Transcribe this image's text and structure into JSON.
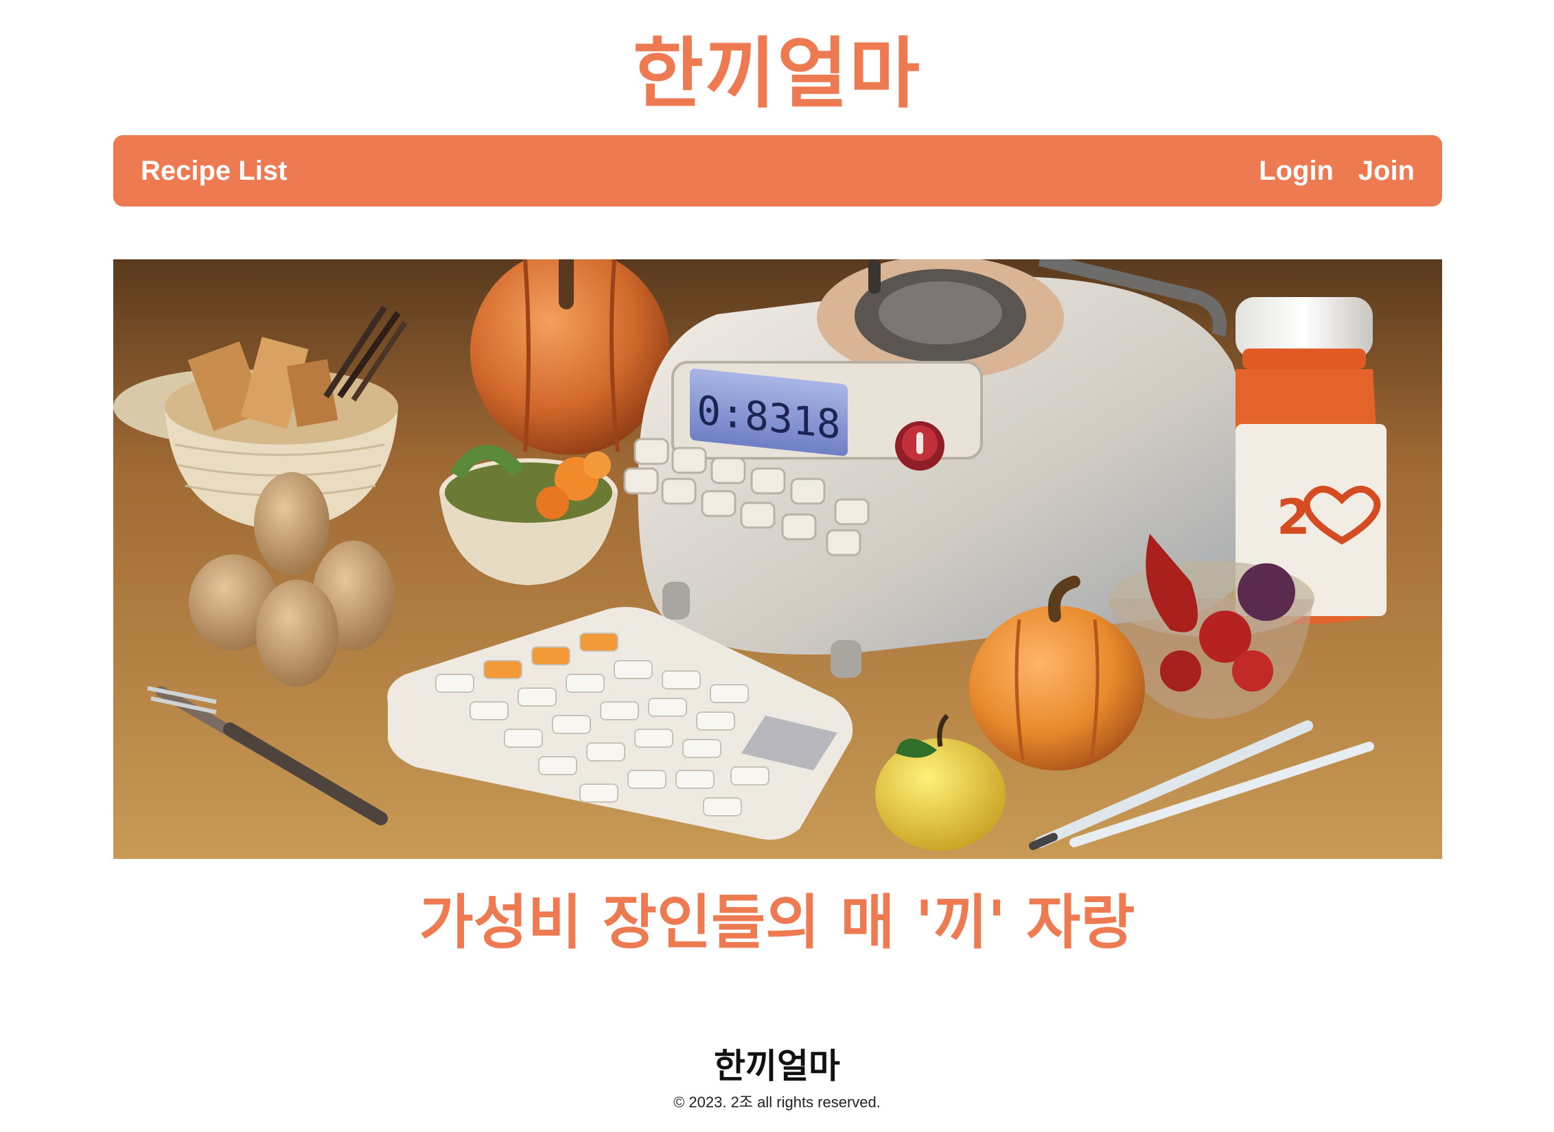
{
  "header": {
    "site_title": "한끼얼마"
  },
  "nav": {
    "recipe_list": "Recipe List",
    "login": "Login",
    "join": "Join"
  },
  "hero": {
    "display_reading": "0:8318"
  },
  "main": {
    "tagline": "가성비 장인들의 매 '끼' 자랑"
  },
  "footer": {
    "title": "한끼얼마",
    "copyright": "© 2023. 2조 all rights reserved."
  },
  "colors": {
    "accent": "#EE7A52",
    "nav_text": "#FFFFFF",
    "footer_text": "#111111"
  }
}
